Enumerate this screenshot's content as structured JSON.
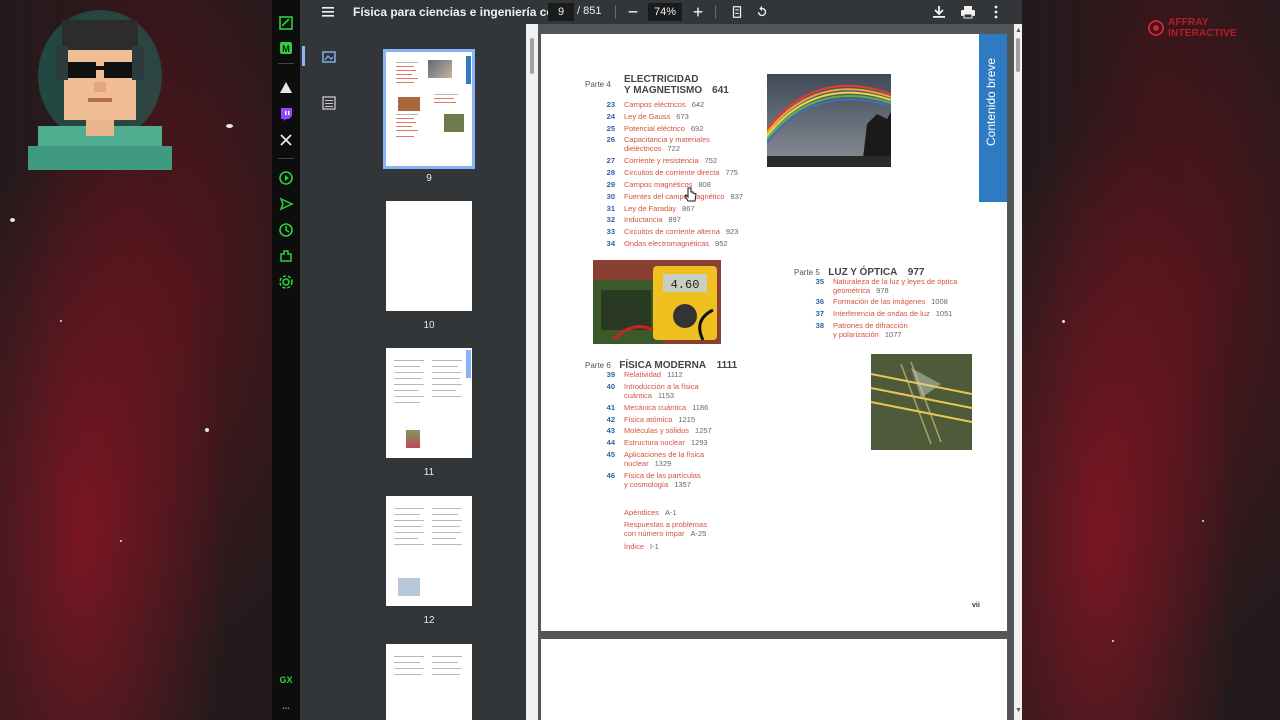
{
  "window": {
    "doc_title": "Física para ciencias e ingeniería co...",
    "current_page": "9",
    "total_pages": "/ 851",
    "zoom": "74%"
  },
  "overlay": {
    "brand_name": "AFFRAY INTERACTIVE"
  },
  "sidebar": {
    "gx_label": "GX",
    "more_label": "..."
  },
  "icons": {
    "toolbar": [
      "menu-icon",
      "zoom-out-icon",
      "zoom-in-icon",
      "fit-page-icon",
      "rotate-icon",
      "download-icon",
      "print-icon",
      "more-vert-icon"
    ],
    "panel": [
      "thumbnails-icon",
      "outline-icon"
    ]
  },
  "thumbnails": [
    {
      "label": "9",
      "selected": true
    },
    {
      "label": "10",
      "selected": false
    },
    {
      "label": "11",
      "selected": false
    },
    {
      "label": "12",
      "selected": false
    }
  ],
  "page": {
    "side_tab": "Contenido breve",
    "page_number": "vii",
    "part4": {
      "label": "Parte 4",
      "title_line1": "ELECTRICIDAD",
      "title_line2": "Y MAGNETISMO",
      "page": "641",
      "chapters": [
        {
          "num": "23",
          "title": "Campos eléctricos",
          "page": "642"
        },
        {
          "num": "24",
          "title": "Ley de Gauss",
          "page": "673"
        },
        {
          "num": "25",
          "title": "Potencial eléctrico",
          "page": "692"
        },
        {
          "num": "26",
          "title": "Capacitancia y materiales",
          "title2": "dieléctricos",
          "page": "722"
        },
        {
          "num": "27",
          "title": "Corriente y resistencia",
          "page": "752"
        },
        {
          "num": "28",
          "title": "Circuitos de corriente directa",
          "page": "775"
        },
        {
          "num": "29",
          "title": "Campos magnéticos",
          "page": "808"
        },
        {
          "num": "30",
          "title": "Fuentes del campo magnético",
          "page": "837"
        },
        {
          "num": "31",
          "title": "Ley de Faraday",
          "page": "867"
        },
        {
          "num": "32",
          "title": "Inductancia",
          "page": "897"
        },
        {
          "num": "33",
          "title": "Circuitos de corriente alterna",
          "page": "923"
        },
        {
          "num": "34",
          "title": "Ondas electromagnéticas",
          "page": "952"
        }
      ]
    },
    "part5": {
      "label": "Parte 5",
      "title": "LUZ Y ÓPTICA",
      "page": "977",
      "chapters": [
        {
          "num": "35",
          "title": "Naturaleza de la luz y leyes de óptica",
          "title2": "geométrica",
          "page": "978"
        },
        {
          "num": "36",
          "title": "Formación de las imágenes",
          "page": "1008"
        },
        {
          "num": "37",
          "title": "Interferencia de ondas de luz",
          "page": "1051"
        },
        {
          "num": "38",
          "title": "Patrones de difracción",
          "title2": "y polarización",
          "page": "1077"
        }
      ]
    },
    "part6": {
      "label": "Parte 6",
      "title": "FÍSICA MODERNA",
      "page": "1111",
      "chapters": [
        {
          "num": "39",
          "title": "Relatividad",
          "page": "1112"
        },
        {
          "num": "40",
          "title": "Introducción a la física",
          "title2": "cuántica",
          "page": "1153"
        },
        {
          "num": "41",
          "title": "Mecánica cuántica",
          "page": "1186"
        },
        {
          "num": "42",
          "title": "Física atómica",
          "page": "1215"
        },
        {
          "num": "43",
          "title": "Moléculas y sólidos",
          "page": "1257"
        },
        {
          "num": "44",
          "title": "Estructura nuclear",
          "page": "1293"
        },
        {
          "num": "45",
          "title": "Aplicaciones de la física",
          "title2": "nuclear",
          "page": "1329"
        },
        {
          "num": "46",
          "title": "Física de las partículas",
          "title2": "y cosmología",
          "page": "1357"
        }
      ]
    },
    "appendix": [
      {
        "title": "Apéndices",
        "page": "A-1"
      },
      {
        "title": "Respuestas a problemas",
        "title2": "con número impar",
        "page": "A-25"
      },
      {
        "title": "Índice",
        "page": "I-1"
      }
    ]
  },
  "colors": {
    "accent_blue": "#2e7bc4",
    "chapter_title": "#d4533c",
    "chapter_num": "#2a63a8",
    "gx_green": "#2ad13a",
    "brand_red": "#b81e27"
  }
}
